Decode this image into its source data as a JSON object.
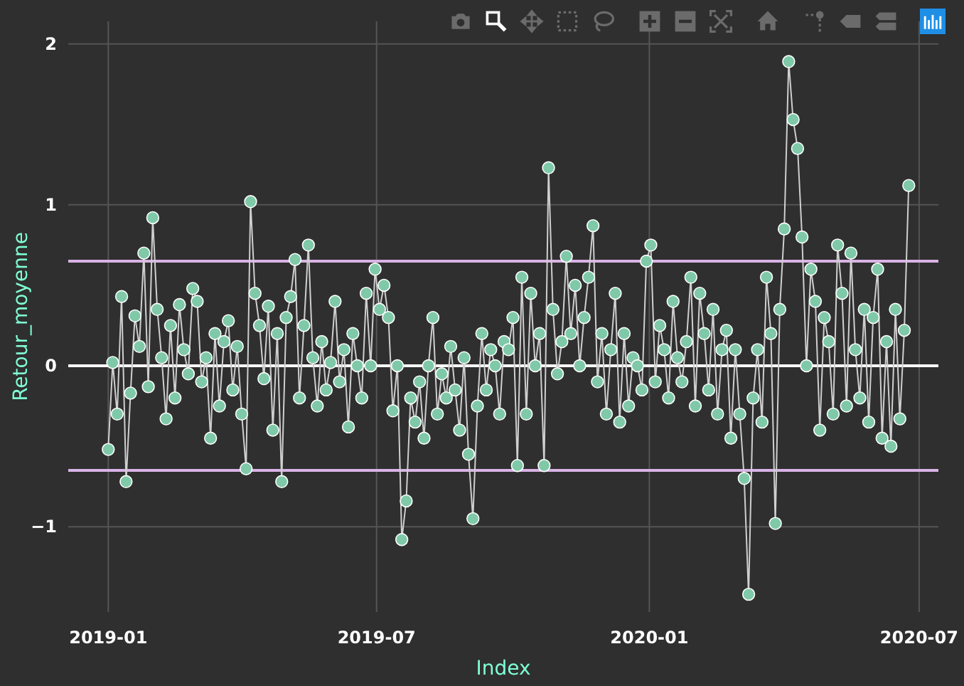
{
  "modebar": [
    {
      "kind": "camera",
      "selected": false
    },
    {
      "kind": "zoom",
      "selected": true
    },
    {
      "kind": "pan",
      "selected": false
    },
    {
      "kind": "select",
      "selected": false
    },
    {
      "kind": "lasso",
      "selected": false
    },
    {
      "kind": "zoomin",
      "selected": false
    },
    {
      "kind": "zoomout",
      "selected": false
    },
    {
      "kind": "autoscale",
      "selected": false
    },
    {
      "kind": "home",
      "selected": false
    },
    {
      "kind": "spike",
      "selected": false
    },
    {
      "kind": "closest",
      "selected": false
    },
    {
      "kind": "compare",
      "selected": false
    },
    {
      "kind": "logo",
      "selected": false
    }
  ],
  "chart": {
    "chart_data": {
      "type": "line",
      "xlabel": "Index",
      "ylabel": "Retour_moyenne",
      "x": [
        "2019-01-01",
        "2019-01-04",
        "2019-01-07",
        "2019-01-10",
        "2019-01-13",
        "2019-01-16",
        "2019-01-19",
        "2019-01-22",
        "2019-01-25",
        "2019-01-28",
        "2019-01-31",
        "2019-02-03",
        "2019-02-06",
        "2019-02-09",
        "2019-02-12",
        "2019-02-15",
        "2019-02-18",
        "2019-02-21",
        "2019-02-24",
        "2019-02-27",
        "2019-03-02",
        "2019-03-05",
        "2019-03-08",
        "2019-03-11",
        "2019-03-14",
        "2019-03-17",
        "2019-03-20",
        "2019-03-23",
        "2019-03-26",
        "2019-03-29",
        "2019-04-01",
        "2019-04-04",
        "2019-04-07",
        "2019-04-10",
        "2019-04-13",
        "2019-04-16",
        "2019-04-19",
        "2019-04-22",
        "2019-04-25",
        "2019-04-28",
        "2019-05-01",
        "2019-05-04",
        "2019-05-07",
        "2019-05-10",
        "2019-05-13",
        "2019-05-16",
        "2019-05-19",
        "2019-05-22",
        "2019-05-25",
        "2019-05-28",
        "2019-05-31",
        "2019-06-03",
        "2019-06-06",
        "2019-06-09",
        "2019-06-12",
        "2019-06-15",
        "2019-06-18",
        "2019-06-21",
        "2019-06-24",
        "2019-06-27",
        "2019-06-30",
        "2019-07-03",
        "2019-07-06",
        "2019-07-09",
        "2019-07-12",
        "2019-07-15",
        "2019-07-18",
        "2019-07-21",
        "2019-07-24",
        "2019-07-27",
        "2019-07-30",
        "2019-08-02",
        "2019-08-05",
        "2019-08-08",
        "2019-08-11",
        "2019-08-14",
        "2019-08-17",
        "2019-08-20",
        "2019-08-23",
        "2019-08-26",
        "2019-08-29",
        "2019-09-01",
        "2019-09-04",
        "2019-09-07",
        "2019-09-10",
        "2019-09-13",
        "2019-09-16",
        "2019-09-19",
        "2019-09-22",
        "2019-09-25",
        "2019-09-28",
        "2019-10-01",
        "2019-10-04",
        "2019-10-07",
        "2019-10-10",
        "2019-10-13",
        "2019-10-16",
        "2019-10-19",
        "2019-10-22",
        "2019-10-25",
        "2019-10-28",
        "2019-10-31",
        "2019-11-03",
        "2019-11-06",
        "2019-11-09",
        "2019-11-12",
        "2019-11-15",
        "2019-11-18",
        "2019-11-21",
        "2019-11-24",
        "2019-11-27",
        "2019-11-30",
        "2019-12-03",
        "2019-12-06",
        "2019-12-09",
        "2019-12-12",
        "2019-12-15",
        "2019-12-18",
        "2019-12-21",
        "2019-12-24",
        "2019-12-27",
        "2019-12-30",
        "2020-01-02",
        "2020-01-05",
        "2020-01-08",
        "2020-01-11",
        "2020-01-14",
        "2020-01-17",
        "2020-01-20",
        "2020-01-23",
        "2020-01-26",
        "2020-01-29",
        "2020-02-01",
        "2020-02-04",
        "2020-02-07",
        "2020-02-10",
        "2020-02-13",
        "2020-02-16",
        "2020-02-19",
        "2020-02-22",
        "2020-02-25",
        "2020-02-28",
        "2020-03-02",
        "2020-03-05",
        "2020-03-08",
        "2020-03-11",
        "2020-03-14",
        "2020-03-17",
        "2020-03-20",
        "2020-03-23",
        "2020-03-26",
        "2020-03-29",
        "2020-04-01",
        "2020-04-04",
        "2020-04-07",
        "2020-04-10",
        "2020-04-13",
        "2020-04-16",
        "2020-04-19",
        "2020-04-22",
        "2020-04-25",
        "2020-04-28",
        "2020-05-01",
        "2020-05-04",
        "2020-05-07",
        "2020-05-10",
        "2020-05-13",
        "2020-05-16",
        "2020-05-19",
        "2020-05-22",
        "2020-05-25",
        "2020-05-28",
        "2020-05-31",
        "2020-06-03",
        "2020-06-06",
        "2020-06-09",
        "2020-06-12",
        "2020-06-15",
        "2020-06-18",
        "2020-06-21",
        "2020-06-24"
      ],
      "series": [
        {
          "color": "#7fc9a9",
          "marker": true,
          "values": [
            -0.52,
            0.02,
            -0.3,
            0.43,
            -0.72,
            -0.17,
            0.31,
            0.12,
            0.7,
            -0.13,
            0.92,
            0.35,
            0.05,
            -0.33,
            0.25,
            -0.2,
            0.38,
            0.1,
            -0.05,
            0.48,
            0.4,
            -0.1,
            0.05,
            -0.45,
            0.2,
            -0.25,
            0.15,
            0.28,
            -0.15,
            0.12,
            -0.3,
            -0.64,
            1.02,
            0.45,
            0.25,
            -0.08,
            0.37,
            -0.4,
            0.2,
            -0.72,
            0.3,
            0.43,
            0.66,
            -0.2,
            0.25,
            0.75,
            0.05,
            -0.25,
            0.15,
            -0.15,
            0.02,
            0.4,
            -0.1,
            0.1,
            -0.38,
            0.2,
            0.0,
            -0.2,
            0.45,
            0.0,
            0.6,
            0.35,
            0.5,
            0.3,
            -0.28,
            0.0,
            -1.08,
            -0.84,
            -0.2,
            -0.35,
            -0.1,
            -0.45,
            0.0,
            0.3,
            -0.3,
            -0.05,
            -0.2,
            0.12,
            -0.15,
            -0.4,
            0.05,
            -0.55,
            -0.95,
            -0.25,
            0.2,
            -0.15,
            0.1,
            0.0,
            -0.3,
            0.15,
            0.1,
            0.3,
            -0.62,
            0.55,
            -0.3,
            0.45,
            0.0,
            0.2,
            -0.62,
            1.23,
            0.35,
            -0.05,
            0.15,
            0.68,
            0.2,
            0.5,
            0.0,
            0.3,
            0.55,
            0.87,
            -0.1,
            0.2,
            -0.3,
            0.1,
            0.45,
            -0.35,
            0.2,
            -0.25,
            0.05,
            0.0,
            -0.15,
            0.65,
            0.75,
            -0.1,
            0.25,
            0.1,
            -0.2,
            0.4,
            0.05,
            -0.1,
            0.15,
            0.55,
            -0.25,
            0.45,
            0.2,
            -0.15,
            0.35,
            -0.3,
            0.1,
            0.22,
            -0.45,
            0.1,
            -0.3,
            -0.7,
            -1.42,
            -0.2,
            0.1,
            -0.35,
            0.55,
            0.2,
            -0.98,
            0.35,
            0.85,
            1.89,
            1.53,
            1.35,
            0.8,
            0.0,
            0.6,
            0.4,
            -0.4,
            0.3,
            0.15,
            -0.3,
            0.75,
            0.45,
            -0.25,
            0.7,
            0.1,
            -0.2,
            0.35,
            -0.35,
            0.3,
            0.6,
            -0.45,
            0.15,
            -0.5,
            0.35,
            -0.33,
            0.22,
            1.12
          ]
        }
      ],
      "xlim": [
        "2018-12-05",
        "2020-07-14"
      ],
      "ylim": [
        -1.53,
        2.14
      ],
      "xticks": [
        "2019-01",
        "2019-07",
        "2020-01",
        "2020-07"
      ],
      "yticks": [
        -1,
        0,
        1,
        2
      ],
      "grid": true,
      "ref_lines": [
        {
          "axis": "y",
          "value": 0.65,
          "color": "#d9b3e6"
        },
        {
          "axis": "y",
          "value": 0,
          "color": "#ffffff"
        },
        {
          "axis": "y",
          "value": -0.65,
          "color": "#d9b3e6"
        }
      ]
    }
  }
}
